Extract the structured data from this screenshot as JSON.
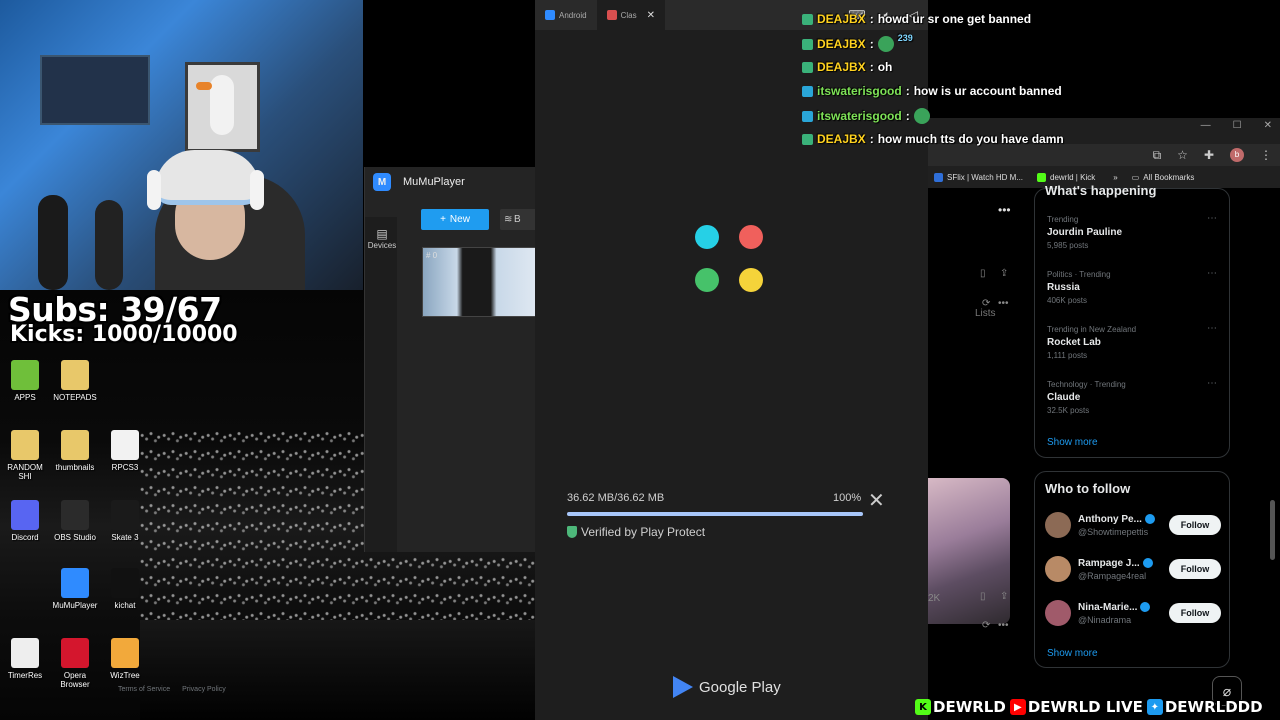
{
  "overlay": {
    "subs": "Subs: 39/67",
    "kicks": "Kicks: 1000/10000",
    "socials": [
      "DEWRLD",
      "DEWRLD LIVE",
      "DEWRLDDD"
    ]
  },
  "desktop": {
    "icons": [
      {
        "label": "APPS",
        "icon": "folder-green-icon"
      },
      {
        "label": "NOTEPADS",
        "icon": "folder-icon"
      },
      {
        "label": "RANDOM SHI",
        "icon": "folder-icon"
      },
      {
        "label": "thumbnails",
        "icon": "folder-icon"
      },
      {
        "label": "RPCS3",
        "icon": "file-icon"
      },
      {
        "label": "Discord",
        "icon": "discord-icon"
      },
      {
        "label": "OBS Studio",
        "icon": "obs-icon"
      },
      {
        "label": "Skate 3",
        "icon": "skate-icon"
      },
      {
        "label": "MuMuPlayer",
        "icon": "mumu-icon"
      },
      {
        "label": "kichat",
        "icon": "kick-icon"
      },
      {
        "label": "TimerRes",
        "icon": "clock-icon"
      },
      {
        "label": "Opera Browser",
        "icon": "opera-icon"
      },
      {
        "label": "WizTree",
        "icon": "wiztree-icon"
      }
    ]
  },
  "mumu": {
    "title": "MuMuPlayer",
    "devices_label": "Devices",
    "new_button": "New",
    "instance_badge": "# 0"
  },
  "emulator": {
    "tabs": [
      {
        "label": "Android",
        "active": false,
        "color": "#2f8bff"
      },
      {
        "label": "Clas",
        "active": true,
        "color": "#d94f4f"
      }
    ],
    "download": {
      "size": "36.62 MB/36.62 MB",
      "percent_label": "100%",
      "progress": 1.0,
      "verified_text": "Verified by Play Protect"
    },
    "store_label": "Google Play",
    "dot_colors": [
      "#26d0e6",
      "#f0605c",
      "#46c26a",
      "#f5d33a"
    ]
  },
  "chat": {
    "messages": [
      {
        "user": "DEAJBX",
        "text": "howd ur sr one get banned",
        "color": "#ffd21f",
        "emote": false
      },
      {
        "user": "DEAJBX",
        "text": "",
        "color": "#ffd21f",
        "emote": true,
        "emote_count": "239"
      },
      {
        "user": "DEAJBX",
        "text": "oh",
        "color": "#ffd21f",
        "emote": false
      },
      {
        "user": "itswaterisgood",
        "text": "how is ur account banned",
        "color": "#7ee257",
        "emote": false
      },
      {
        "user": "itswaterisgood",
        "text": "",
        "color": "#7ee257",
        "emote": true,
        "emote_count": ""
      },
      {
        "user": "DEAJBX",
        "text": "how much tts do you have damn",
        "color": "#ffd21f",
        "emote": false
      }
    ]
  },
  "browser": {
    "bookmarks": [
      "SFlix | Watch HD M...",
      "dewrld | Kick",
      "All Bookmarks"
    ],
    "x": {
      "lists_label": "Lists",
      "happening_title": "What's happening",
      "trends": [
        {
          "category": "Trending",
          "name": "Jourdin Pauline",
          "count": "5,985 posts"
        },
        {
          "category": "Politics · Trending",
          "name": "Russia",
          "count": "406K posts"
        },
        {
          "category": "Trending in New Zealand",
          "name": "Rocket Lab",
          "count": "1,111 posts"
        },
        {
          "category": "Technology · Trending",
          "name": "Claude",
          "count": "32.5K posts"
        }
      ],
      "show_more": "Show more",
      "who_to_follow": "Who to follow",
      "follows": [
        {
          "name": "Anthony Pe...",
          "handle": "@Showtimepettis",
          "button": "Follow",
          "avatar_color": "#8c6a55"
        },
        {
          "name": "Rampage J...",
          "handle": "@Rampage4real",
          "button": "Follow",
          "avatar_color": "#b88a66"
        },
        {
          "name": "Nina-Marie...",
          "handle": "@Ninadrama",
          "button": "Follow",
          "avatar_color": "#a05a6a"
        }
      ],
      "footer": [
        "Terms of Service",
        "Privacy Policy"
      ],
      "counter": "2K"
    }
  }
}
